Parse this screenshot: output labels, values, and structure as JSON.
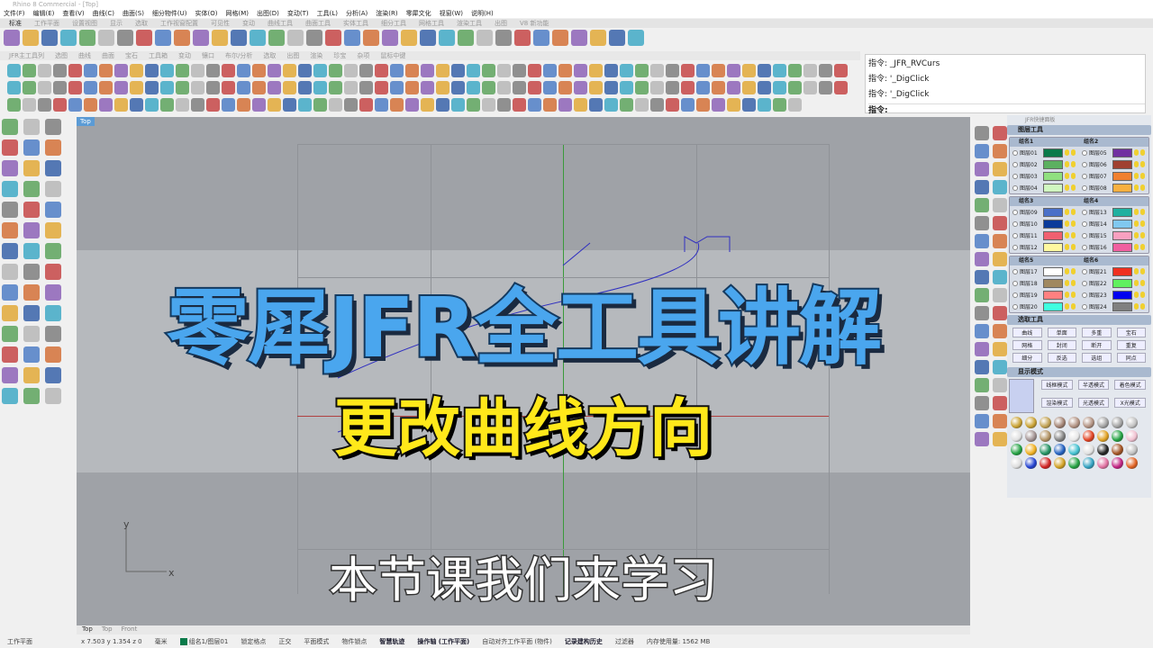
{
  "window": {
    "title": "Rhino 8 Commercial - [Top]"
  },
  "menu": [
    "文件(F)",
    "编辑(E)",
    "查看(V)",
    "曲线(C)",
    "曲面(S)",
    "细分物件(U)",
    "实体(O)",
    "网格(M)",
    "出图(D)",
    "变动(T)",
    "工具(L)",
    "分析(A)",
    "渲染(R)",
    "零犀文化",
    "视窗(W)",
    "说明(H)"
  ],
  "toolbar_tabs": [
    "标准",
    "工作平面",
    "设置视图",
    "显示",
    "选取",
    "工作视窗配置",
    "可见性",
    "变动",
    "曲线工具",
    "曲面工具",
    "实体工具",
    "细分工具",
    "网格工具",
    "渲染工具",
    "出图",
    "V8 新功能"
  ],
  "jfr_tabs": [
    "JFR主工具列",
    "选图",
    "曲线",
    "曲面",
    "宝石",
    "工具箱",
    "变动",
    "镶口",
    "布尔/分析",
    "选取",
    "出图",
    "渲染",
    "珍宝",
    "杂项",
    "鼠标中键"
  ],
  "command": {
    "history": [
      "指令: _JFR_RVCurs",
      "指令: '_DigClick",
      "指令: '_DigClick"
    ],
    "prompt": "指令:"
  },
  "viewport": {
    "name": "Top",
    "axis_x": "x",
    "axis_y": "y",
    "tabs": [
      "Top",
      "Top",
      "Front"
    ]
  },
  "overlay": {
    "title": "零犀JFR全工具讲解",
    "subtitle": "更改曲线方向",
    "caption": "本节课我们来学习"
  },
  "panel": {
    "title": "JFR快捷面板",
    "layer_tools": "图层工具",
    "groups": [
      {
        "a": "组名1",
        "b": "组名2",
        "rows": [
          [
            "图层01",
            "#0a7a4a",
            "图层05",
            "#7030a0"
          ],
          [
            "图层02",
            "#5cb060",
            "图层06",
            "#a04030"
          ],
          [
            "图层03",
            "#90e080",
            "图层07",
            "#f08030"
          ],
          [
            "图层04",
            "#d0f8c0",
            "图层08",
            "#f8b040"
          ]
        ]
      },
      {
        "a": "组名3",
        "b": "组名4",
        "rows": [
          [
            "图层09",
            "#4a70c8",
            "图层13",
            "#20b0a0"
          ],
          [
            "图层10",
            "#0a3a9a",
            "图层14",
            "#80c8f0"
          ],
          [
            "图层11",
            "#f06070",
            "图层15",
            "#f8a0c0"
          ],
          [
            "图层12",
            "#fff8a0",
            "图层16",
            "#f060a0"
          ]
        ]
      },
      {
        "a": "组名5",
        "b": "组名6",
        "rows": [
          [
            "图层17",
            "#ffffff",
            "图层21",
            "#f03020"
          ],
          [
            "图层18",
            "#a08860",
            "图层22",
            "#60f060"
          ],
          [
            "图层19",
            "#ff8080",
            "图层23",
            "#0000f0"
          ],
          [
            "图层20",
            "#40ffe0",
            "图层24",
            "#808080"
          ]
        ]
      }
    ],
    "select_tools": "选取工具",
    "select_buttons": [
      "曲线",
      "单面",
      "多重",
      "宝石",
      "网格",
      "封闭",
      "断开",
      "重复",
      "细分",
      "反选",
      "选组",
      "同点"
    ],
    "display_mode": "显示模式",
    "display_buttons": [
      "线框模式",
      "半透模式",
      "着色模式",
      "渲染模式",
      "光透模式",
      "X光模式"
    ]
  },
  "status": {
    "cplane": "工作平面",
    "coords": "x 7.503  y 1.354  z 0",
    "units": "毫米",
    "layer": "组名1/图层01",
    "items": [
      "锁定格点",
      "正交",
      "平面模式",
      "物件锁点"
    ],
    "highlight": [
      "智慧轨迹",
      "操作轴 (工作平面)"
    ],
    "autoalign": "自动对齐工作平面 (物件)",
    "history": "记录建构历史",
    "filter": "过滤器",
    "memory": "内存使用量: 1562 MB"
  }
}
